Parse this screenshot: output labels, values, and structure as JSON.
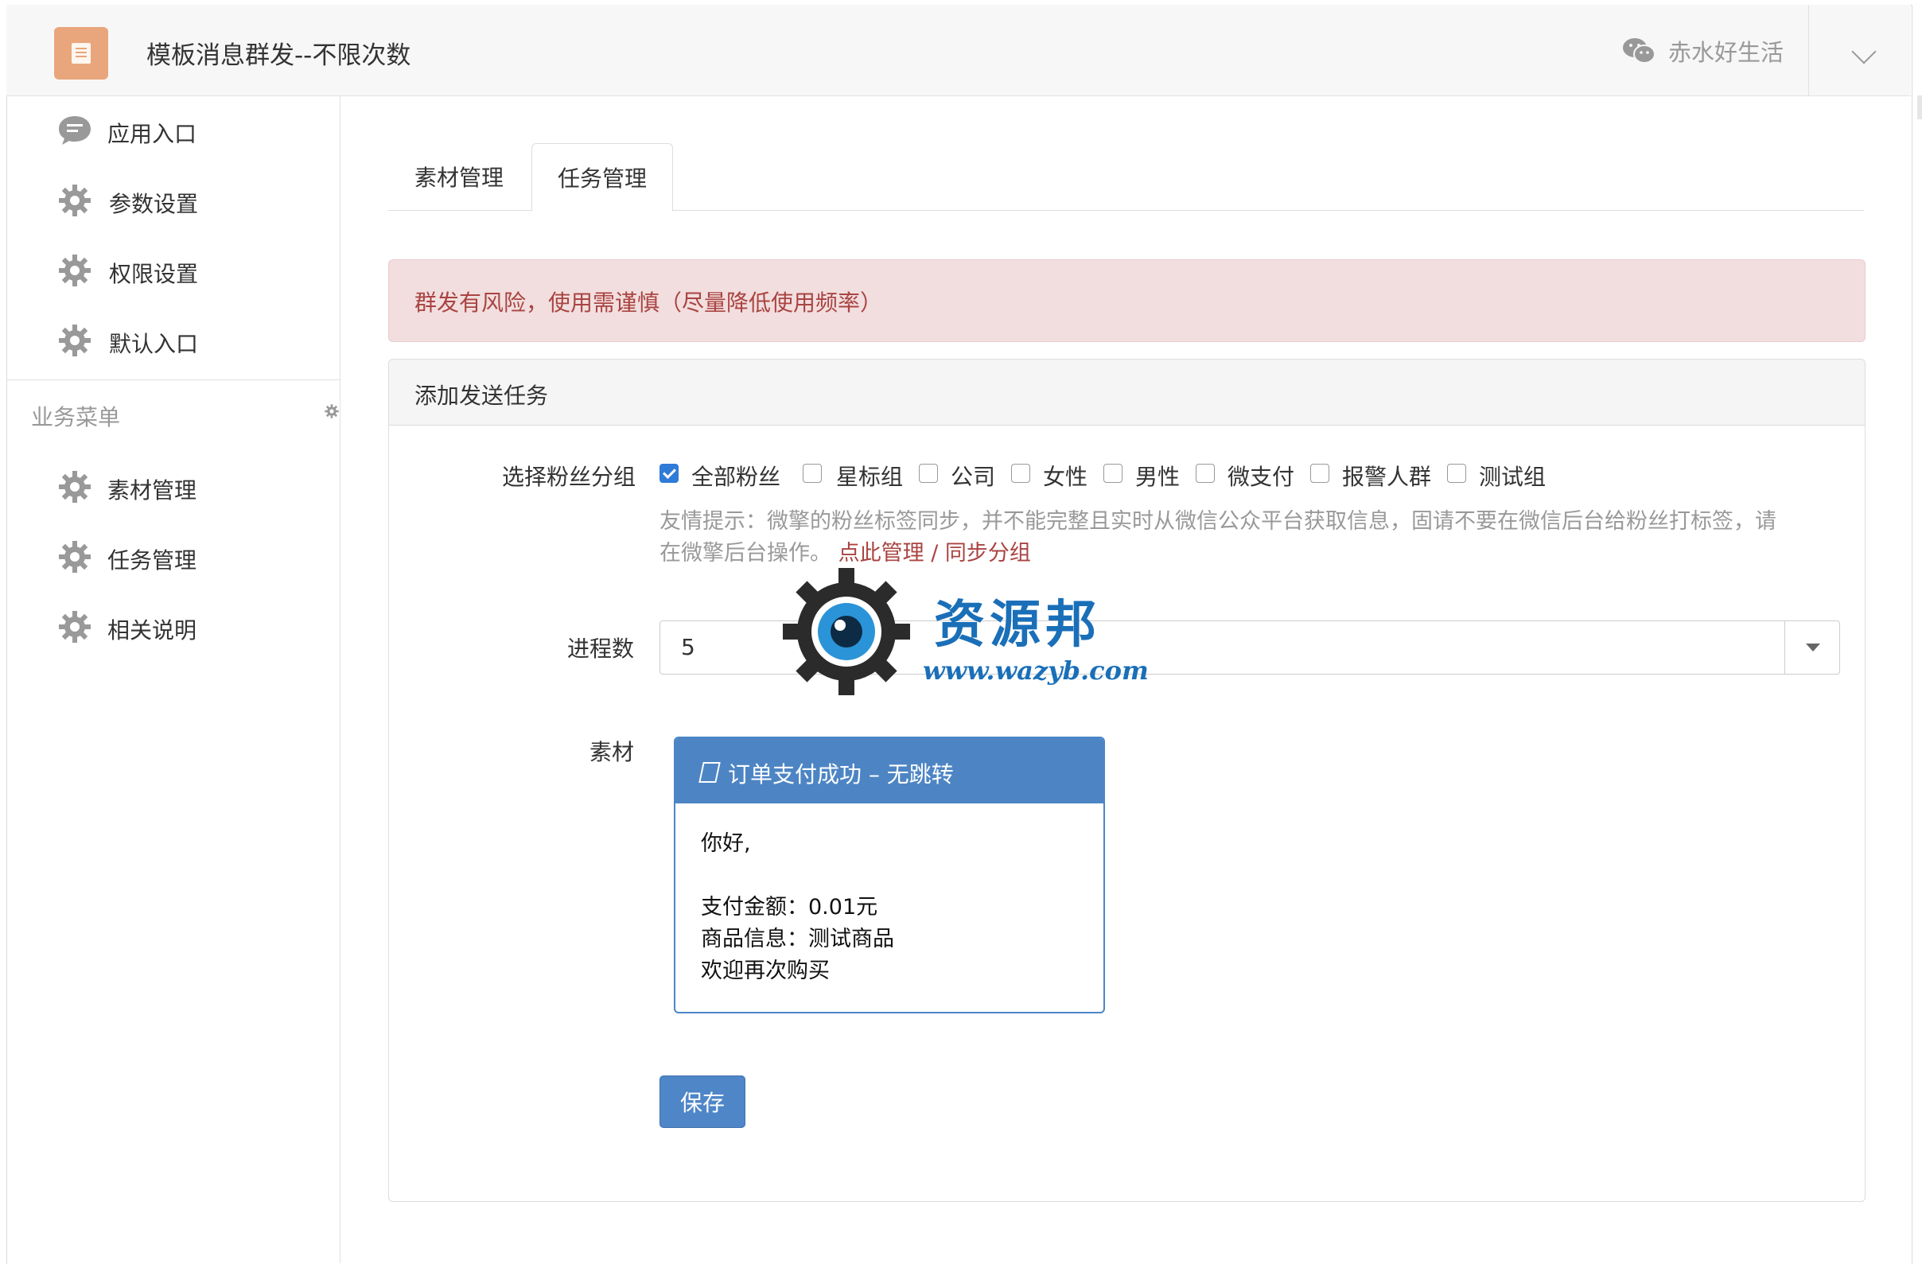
{
  "header": {
    "title": "模板消息群发--不限次数",
    "account_name": "赤水好生活",
    "account_icon": "wechat-icon",
    "dropdown_icon": "chevron-down-icon"
  },
  "sidebar": {
    "items": [
      {
        "label": "应用入口",
        "icon": "chat-bubble-icon"
      },
      {
        "label": "参数设置",
        "icon": "gear-icon"
      },
      {
        "label": "权限设置",
        "icon": "gear-icon"
      },
      {
        "label": "默认入口",
        "icon": "gear-icon"
      }
    ],
    "section_title": "业务菜单",
    "section_items": [
      {
        "label": "素材管理",
        "icon": "gear-icon"
      },
      {
        "label": "任务管理",
        "icon": "gear-icon"
      },
      {
        "label": "相关说明",
        "icon": "gear-icon"
      }
    ]
  },
  "tabs": [
    {
      "label": "素材管理",
      "active": false
    },
    {
      "label": "任务管理",
      "active": true
    }
  ],
  "alert": {
    "text": "群发有风险，使用需谨慎（尽量降低使用频率）"
  },
  "panel": {
    "title": "添加发送任务",
    "fans_group": {
      "label": "选择粉丝分组",
      "options": [
        {
          "label": "全部粉丝",
          "checked": true
        },
        {
          "label": "星标组",
          "checked": false
        },
        {
          "label": "公司",
          "checked": false
        },
        {
          "label": "女性",
          "checked": false
        },
        {
          "label": "男性",
          "checked": false
        },
        {
          "label": "微支付",
          "checked": false
        },
        {
          "label": "报警人群",
          "checked": false
        },
        {
          "label": "测试组",
          "checked": false
        }
      ],
      "hint_line1": "友情提示：微擎的粉丝标签同步，并不能完整且实时从微信公众平台获取信息，固请不要在微信后台给粉丝打标签，请",
      "hint_line2": "在微擎后台操作。",
      "link_manage": "点此管理",
      "link_sep": "/",
      "link_sync": "同步分组"
    },
    "process": {
      "label": "进程数",
      "value": "5"
    },
    "material": {
      "label": "素材",
      "card_title": "订单支付成功 – 无跳转",
      "lines": [
        "你好,",
        "",
        "支付金额：0.01元",
        "商品信息：测试商品",
        "欢迎再次购买"
      ]
    },
    "save_label": "保存"
  },
  "watermark": {
    "text": "资源邦",
    "url": "www.wazyb.com"
  },
  "colors": {
    "accent": "#4d85c4",
    "alert_bg": "#f2dede",
    "alert_text": "#a94442",
    "app_icon": "#e9a67c"
  }
}
